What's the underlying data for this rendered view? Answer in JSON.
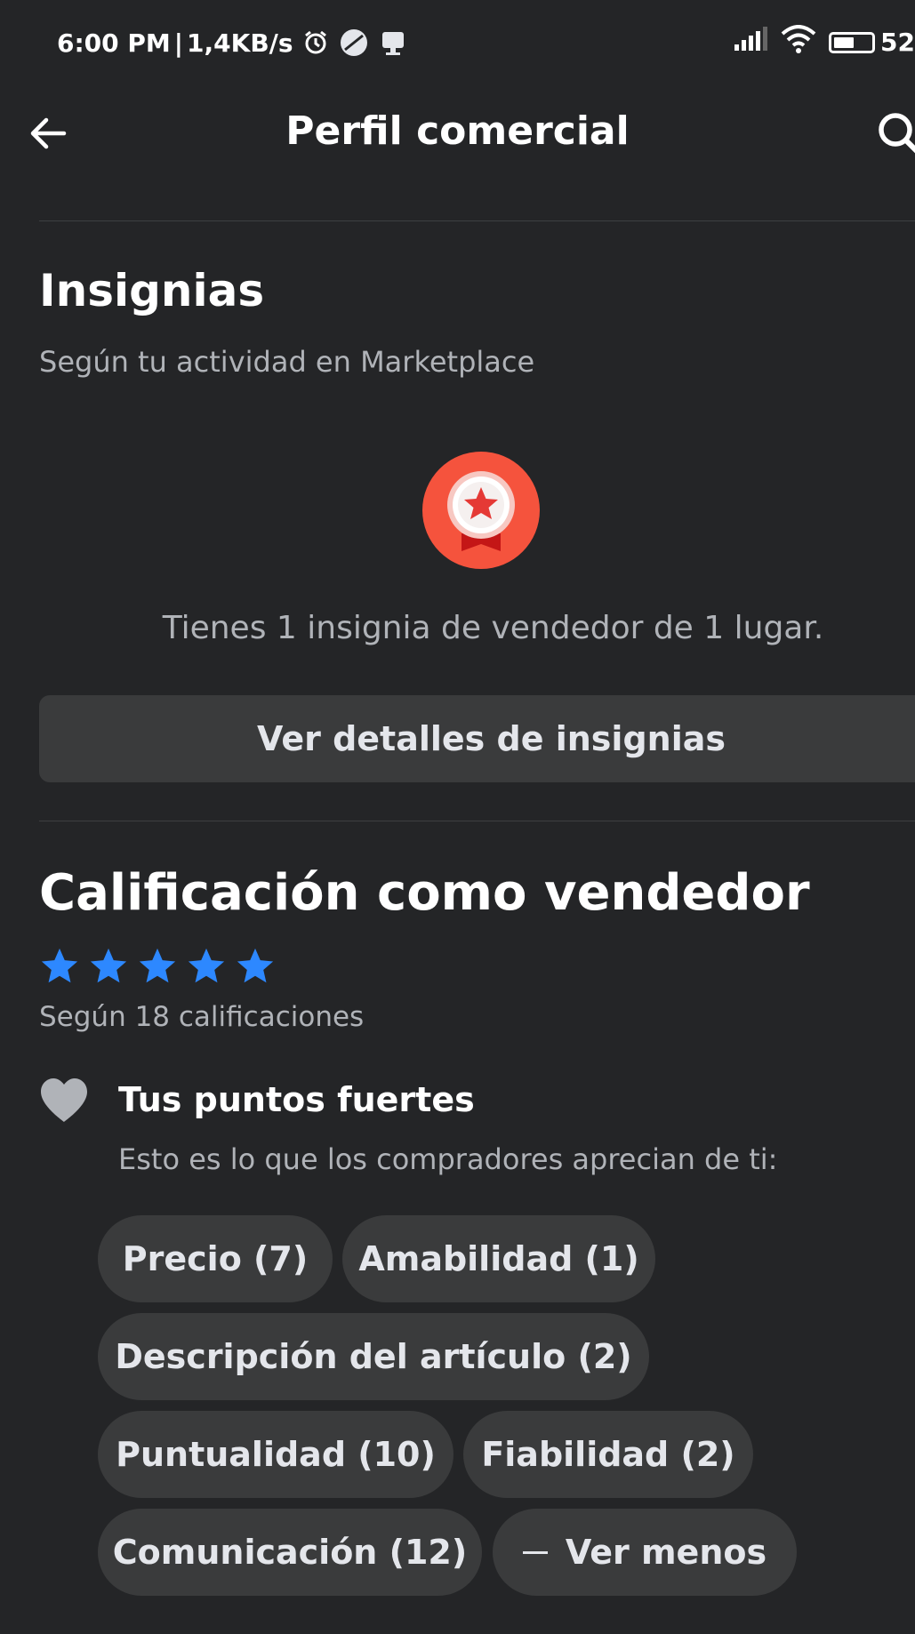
{
  "status_bar": {
    "time": "6:00 PM",
    "separator": "|",
    "speed": "1,4KB/s",
    "battery": "52"
  },
  "app_bar": {
    "title": "Perfil comercial"
  },
  "badges": {
    "title": "Insignias",
    "subtitle": "Según tu actividad en Marketplace",
    "summary": "Tienes 1 insignia de vendedor de 1 lugar.",
    "details_button": "Ver detalles de insignias"
  },
  "rating": {
    "title": "Calificación como vendedor",
    "stars": 5,
    "count_text": "Según 18 calificaciones"
  },
  "strengths": {
    "title": "Tus puntos fuertes",
    "description": "Esto es lo que los compradores aprecian de ti:",
    "chips": [
      "Precio (7)",
      "Amabilidad (1)",
      "Descripción del artículo (2)",
      "Puntualidad (10)",
      "Fiabilidad (2)",
      "Comunicación (12)"
    ],
    "see_less": "Ver menos"
  },
  "colors": {
    "background": "#242527",
    "chip": "#3a3b3c",
    "star": "#2d88ff",
    "badge": "#f5533d"
  }
}
